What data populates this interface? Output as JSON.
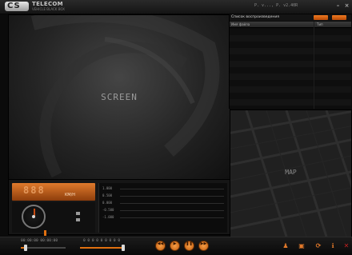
{
  "app": {
    "logo_mark": "CS",
    "logo_text": "TELECOM",
    "logo_subtitle": "VEHICLE BLACK BOX",
    "version": "P. v..., P. v2.40R"
  },
  "window": {
    "minimize": "–",
    "close": "×"
  },
  "video": {
    "label": "SCREEN"
  },
  "playlist": {
    "title": "Список воспроизведения",
    "columns": {
      "name": "Имя файла",
      "type": "Тип"
    },
    "rows": [
      {},
      {},
      {},
      {},
      {},
      {},
      {},
      {},
      {},
      {},
      {},
      {}
    ]
  },
  "map": {
    "label": "MAP"
  },
  "speed": {
    "value": "888",
    "unit": "KM/H"
  },
  "gsensor": {
    "labels": [
      "1.000",
      "0.500",
      "0.000",
      "-0.500",
      "-1.000"
    ]
  },
  "timeline": {
    "current": "00:00:00  00:00:00",
    "total": "0 0 0 0 0 0 0 0 0"
  },
  "controls": [
    {
      "name": "rewind-button",
      "icon": "rewind-icon",
      "glyph": "◀◀"
    },
    {
      "name": "play-button",
      "icon": "play-icon",
      "glyph": "▶"
    },
    {
      "name": "pause-button",
      "icon": "pause-icon",
      "glyph": "❚❚"
    },
    {
      "name": "fast-forward-button",
      "icon": "fast-forward-icon",
      "glyph": "▶▶"
    }
  ],
  "right_icons": [
    {
      "name": "person-button",
      "icon": "person-icon",
      "glyph": "♟"
    },
    {
      "name": "camera-button",
      "icon": "camera-icon",
      "glyph": "▣"
    },
    {
      "name": "refresh-button",
      "icon": "refresh-icon",
      "glyph": "⟳"
    },
    {
      "name": "info-button",
      "icon": "info-icon",
      "glyph": "ℹ"
    },
    {
      "name": "close-app-button",
      "icon": "close-icon",
      "glyph": "✕"
    }
  ],
  "colors": {
    "accent": "#e07010",
    "background": "#0b0b0b"
  }
}
